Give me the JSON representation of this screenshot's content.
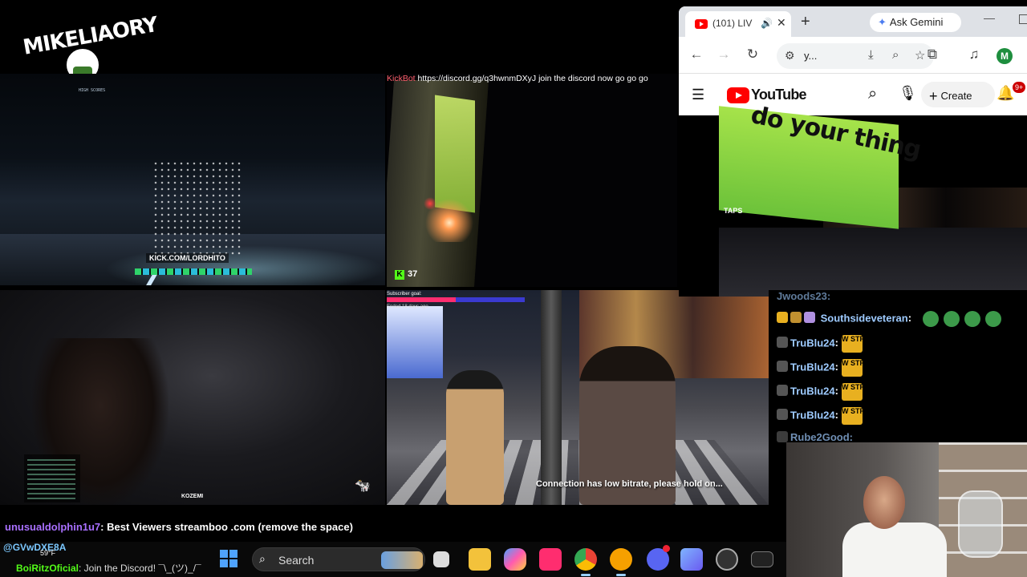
{
  "logo": {
    "text": "MIKELIAORY"
  },
  "tiles": {
    "top_left": {
      "scores_title": "HIGH SCORES",
      "kick_url": "KICK.COM/LORDHITO"
    },
    "top_middle": {
      "chat_user": "KickBot",
      "chat_message": "https://discord.gg/q3hwnmDXyJ join the discord now go go go",
      "viewer_count": "37"
    },
    "bottom_left": {
      "tag": "KOZEMI"
    },
    "bottom_middle": {
      "subscriber_goal": "Subscriber goal:",
      "ended": "Ended 18 days ago",
      "connection_notice": "Connection has low bitrate, please hold on..."
    }
  },
  "chrome": {
    "tab_title": "(101) LIV",
    "gemini_label": "Ask Gemini",
    "url": "y...",
    "avatar_letter": "M"
  },
  "youtube": {
    "brand": "YouTube",
    "create_label": "Create",
    "notifications": "9+",
    "billboard_text": "do your thing",
    "storefront": "TAPS"
  },
  "chat": {
    "messages": [
      {
        "user": "Southsideveteran",
        "emote": "emotes",
        "color": "#9ecbff"
      },
      {
        "user": "TruBlu24",
        "emote": "W STREAM",
        "color": "#9ecbff"
      },
      {
        "user": "TruBlu24",
        "emote": "W STREAM",
        "color": "#9ecbff"
      },
      {
        "user": "TruBlu24",
        "emote": "W STREAM",
        "color": "#9ecbff"
      },
      {
        "user": "TruBlu24",
        "emote": "W STREAM",
        "color": "#9ecbff"
      }
    ],
    "partial_top": "Jwoods23:",
    "partial_bottom": "Rube2Good:"
  },
  "ticker": {
    "user": "unusualdolphin1u7",
    "message": ": Best Viewers streamboo .com (remove the space)"
  },
  "overlay": {
    "user": "@GVwDXE8A",
    "temp": "59°F",
    "msg_user": "BoiRitzOficial",
    "msg_text": ": Join the Discord! ¯\\_(ツ)_/¯"
  },
  "taskbar": {
    "search_label": "Search"
  },
  "colors": {
    "kick_green": "#53fc18",
    "youtube_red": "#ff0000"
  }
}
